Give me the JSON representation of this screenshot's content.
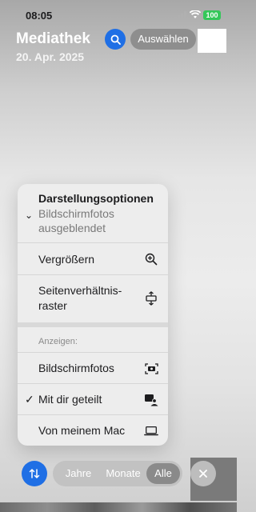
{
  "status_bar": {
    "time": "08:05",
    "battery": "100"
  },
  "header": {
    "title": "Mediathek",
    "date": "20. Apr. 2025",
    "select_label": "Auswählen"
  },
  "menu": {
    "title": "Darstellungsoptionen",
    "subtitle_line1": "Bildschirmfotos",
    "subtitle_line2": "ausgeblendet",
    "zoom_label": "Vergrößern",
    "aspect_line1": "Seitenverhältnis-",
    "aspect_line2": "raster",
    "show_section": "Anzeigen:",
    "screenshots_label": "Bildschirmfotos",
    "shared_label": "Mit dir geteilt",
    "mac_label": "Von meinem Mac"
  },
  "bottom_bar": {
    "years": "Jahre",
    "months": "Monate",
    "all": "Alle",
    "selected": "Alle"
  },
  "colors": {
    "accent": "#1f6fe5",
    "battery": "#34c759"
  },
  "icons": [
    "search-icon",
    "zoom-in-icon",
    "aspect-ratio-icon",
    "screenshot-icon",
    "shared-with-you-icon",
    "laptop-icon",
    "sort-icon",
    "close-icon",
    "checkmark-icon"
  ]
}
